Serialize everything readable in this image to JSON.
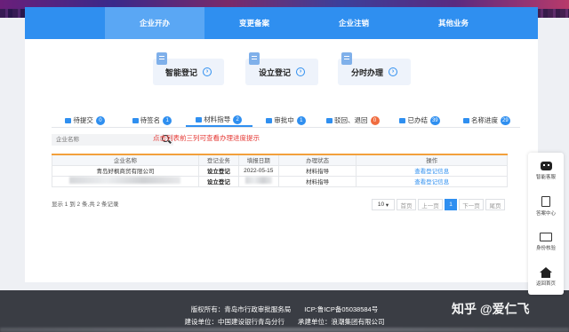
{
  "nav": {
    "tabs": [
      {
        "label": "企业开办",
        "active": true
      },
      {
        "label": "变更备案"
      },
      {
        "label": "企业注销"
      },
      {
        "label": "其他业务"
      }
    ]
  },
  "services": [
    {
      "label": "智能登记",
      "icon": "document-icon"
    },
    {
      "label": "设立登记",
      "icon": "document-icon"
    },
    {
      "label": "分时办理",
      "icon": "document-icon"
    }
  ],
  "status_tabs": [
    {
      "label": "待提交",
      "count": "0"
    },
    {
      "label": "待签名",
      "count": "1"
    },
    {
      "label": "材料指导",
      "count": "2",
      "active": true
    },
    {
      "label": "审批中",
      "count": "1"
    },
    {
      "label": "驳回、退回",
      "count": "0",
      "badge_color": "#f06c3f"
    },
    {
      "label": "已办结",
      "count": "39"
    },
    {
      "label": "名称进度",
      "count": "29"
    }
  ],
  "search": {
    "placeholder": "企业名称"
  },
  "hint": "点击列表前三列可查看办理进度提示",
  "table": {
    "headers": [
      "企业名称",
      "登记业务",
      "填报日期",
      "办理状态",
      "操作"
    ],
    "rows": [
      {
        "name": "青岛好枫商贸有限公司",
        "business": "设立登记",
        "date": "2022-05-15",
        "status": "材料指导",
        "action": "查看登记信息"
      },
      {
        "name": "",
        "business": "设立登记",
        "date": "",
        "status": "材料指导",
        "action": "查看登记信息"
      }
    ]
  },
  "pagination": {
    "info": "显示 1 到 2 条,共 2 条记录",
    "page_size": "10",
    "first": "首页",
    "prev": "上一页",
    "current": "1",
    "next": "下一页",
    "last": "尾页"
  },
  "footer": {
    "line1": "版权所有：青岛市行政审批服务局　　ICP:鲁ICP备05038584号",
    "line2": "建设单位：中国建设银行青岛分行　　承建单位：浪潮集团有限公司"
  },
  "watermark": "知乎 @爱仁飞",
  "side_menu": [
    {
      "label": "智能客服",
      "icon": "robot-icon"
    },
    {
      "label": "答案中心",
      "icon": "document-icon"
    },
    {
      "label": "身份核验",
      "icon": "id-card-icon"
    },
    {
      "label": "返回首页",
      "icon": "home-icon"
    }
  ],
  "colors": {
    "primary": "#2f8ff0",
    "danger": "#e53935",
    "orange": "#f06c3f",
    "footer": "#3a3d44"
  }
}
